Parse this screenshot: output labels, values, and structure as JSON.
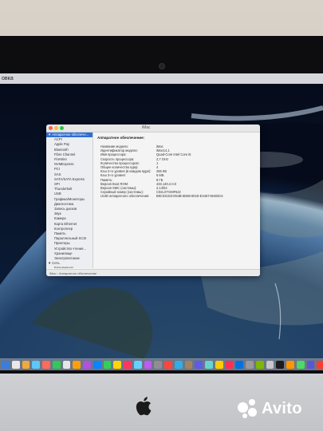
{
  "menubar": {
    "app_label": "овка"
  },
  "window": {
    "title": "iMac",
    "sidebar": {
      "items": [
        {
          "label": "▼ Аппаратное обеспече...",
          "selected": true
        },
        {
          "label": "ACPI"
        },
        {
          "label": "Apple Pay"
        },
        {
          "label": "Bluetooth"
        },
        {
          "label": "Fibre Channel"
        },
        {
          "label": "FireWire"
        },
        {
          "label": "NVMExpress"
        },
        {
          "label": "PCI"
        },
        {
          "label": "SAS"
        },
        {
          "label": "SATA/SATA Express"
        },
        {
          "label": "SPI"
        },
        {
          "label": "Thunderbolt"
        },
        {
          "label": "USB"
        },
        {
          "label": "Графика/Мониторы"
        },
        {
          "label": "Диагностика"
        },
        {
          "label": "Запись дисков"
        },
        {
          "label": "Звук"
        },
        {
          "label": "Камера"
        },
        {
          "label": "Карта Ethernet"
        },
        {
          "label": "Контроллер"
        },
        {
          "label": "Память"
        },
        {
          "label": "Параллельный SCSI"
        },
        {
          "label": "Принтеры"
        },
        {
          "label": "Устройство чтения..."
        },
        {
          "label": "Хранилище"
        },
        {
          "label": "Электропитание"
        },
        {
          "label": "▼ Сеть",
          "head": true
        },
        {
          "label": "Брандмауэр"
        },
        {
          "label": "Wi-Fi"
        },
        {
          "label": "Размещения"
        }
      ]
    },
    "content": {
      "heading": "Аппаратное обеспечение:",
      "rows": [
        {
          "k": "Название модели:",
          "v": "iMac"
        },
        {
          "k": "Идентификатор модели:",
          "v": "iMac14,1"
        },
        {
          "k": "Имя процессора:",
          "v": "Quad-Core Intel Core i5"
        },
        {
          "k": "Скорость процессора:",
          "v": "2,7 GHz"
        },
        {
          "k": "Количество процессоров:",
          "v": "1"
        },
        {
          "k": "Общее количество ядер:",
          "v": "4"
        },
        {
          "k": "Кэш 2-го уровня (в каждом ядре):",
          "v": "256 КБ"
        },
        {
          "k": "Кэш 3-го уровня:",
          "v": "6 МБ"
        },
        {
          "k": "Память:",
          "v": "8 ГБ"
        },
        {
          "k": "Версия Boot ROM:",
          "v": "433.140.2.0.0"
        },
        {
          "k": "Версия SMC (системы):",
          "v": "2.14f24"
        },
        {
          "k": "Серийный номер (системы):",
          "v": "C02LXTGMF8J2"
        },
        {
          "k": "UUID аппаратного обеспечения:",
          "v": "B9C031D3-D54B-5D86-8019-E3467A5603C6"
        }
      ]
    },
    "statusbar": "iMac › Аппаратное обеспечение"
  },
  "watermark": {
    "brand": "Avito"
  },
  "colors": {
    "selection": "#2f6ed3",
    "close": "#fe5f57",
    "minimize": "#febc2e",
    "zoom": "#28c840",
    "avito_dot_1": "#04e061",
    "avito_dot_2": "#ff4053",
    "avito_dot_3": "#965eeb",
    "avito_dot_4": "#0af"
  }
}
